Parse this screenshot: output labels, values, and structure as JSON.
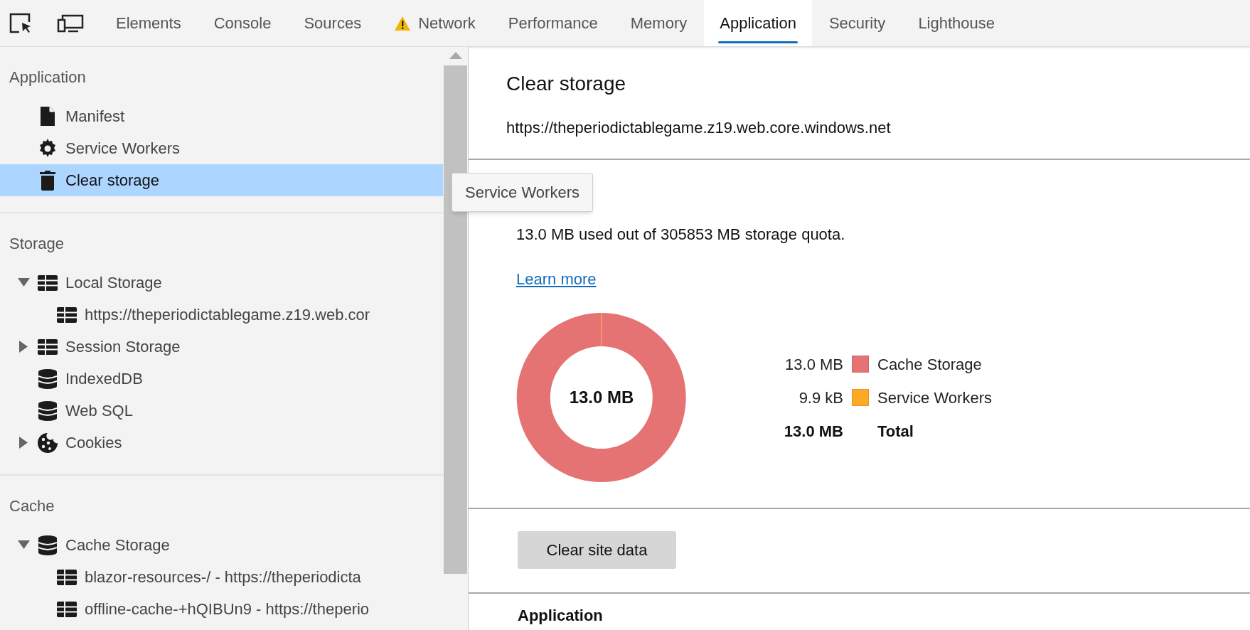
{
  "toolbar": {
    "tabs": [
      {
        "label": "Elements",
        "selected": false,
        "warning": false
      },
      {
        "label": "Console",
        "selected": false,
        "warning": false
      },
      {
        "label": "Sources",
        "selected": false,
        "warning": false
      },
      {
        "label": "Network",
        "selected": false,
        "warning": true
      },
      {
        "label": "Performance",
        "selected": false,
        "warning": false
      },
      {
        "label": "Memory",
        "selected": false,
        "warning": false
      },
      {
        "label": "Application",
        "selected": true,
        "warning": false
      },
      {
        "label": "Security",
        "selected": false,
        "warning": false
      },
      {
        "label": "Lighthouse",
        "selected": false,
        "warning": false
      }
    ]
  },
  "sidebar": {
    "sections": [
      {
        "title": "Application",
        "items": [
          {
            "label": "Manifest",
            "kind": "document",
            "selected": false
          },
          {
            "label": "Service Workers",
            "kind": "worker",
            "selected": false
          },
          {
            "label": "Clear storage",
            "kind": "clear",
            "selected": true
          }
        ]
      },
      {
        "title": "Storage",
        "items": [
          {
            "label": "Local Storage",
            "kind": "table",
            "selected": false,
            "expanded": true,
            "children": [
              {
                "label": "https://theperiodictablegame.z19.web.cor",
                "kind": "table",
                "selected": false
              }
            ]
          },
          {
            "label": "Session Storage",
            "kind": "table",
            "selected": false,
            "expanded": false
          },
          {
            "label": "IndexedDB",
            "kind": "database",
            "selected": false
          },
          {
            "label": "Web SQL",
            "kind": "database",
            "selected": false
          },
          {
            "label": "Cookies",
            "kind": "cookie",
            "selected": false,
            "expanded": false
          }
        ]
      },
      {
        "title": "Cache",
        "items": [
          {
            "label": "Cache Storage",
            "kind": "database",
            "selected": false,
            "expanded": true,
            "children": [
              {
                "label": "blazor-resources-/ - https://theperiodicta",
                "kind": "table",
                "selected": false
              },
              {
                "label": "offline-cache-+hQIBUn9 - https://theperio",
                "kind": "table",
                "selected": false
              }
            ]
          }
        ]
      }
    ]
  },
  "main": {
    "title": "Clear storage",
    "origin": "https://theperiodictablegame.z19.web.core.windows.net",
    "usage": {
      "summary": "13.0 MB used out of 305853 MB storage quota.",
      "link": "Learn more",
      "center_label": "13.0 MB",
      "chart_data": {
        "type": "donut",
        "categories": [
          "Cache Storage",
          "Service Workers"
        ],
        "series": [
          {
            "values": [
              99.92,
              0.08
            ]
          }
        ]
      },
      "legend": [
        {
          "value": "13.0 MB",
          "color": "#e57373",
          "kind": "entry"
        },
        {
          "value": "9.9 kB",
          "color": "#ffa726",
          "kind": "entry"
        },
        {
          "value": "13.0 MB",
          "label": "Total",
          "kind": "total"
        }
      ]
    },
    "clear_button": "Clear site data",
    "next_section": "Application"
  },
  "tooltip": "Service Workers"
}
